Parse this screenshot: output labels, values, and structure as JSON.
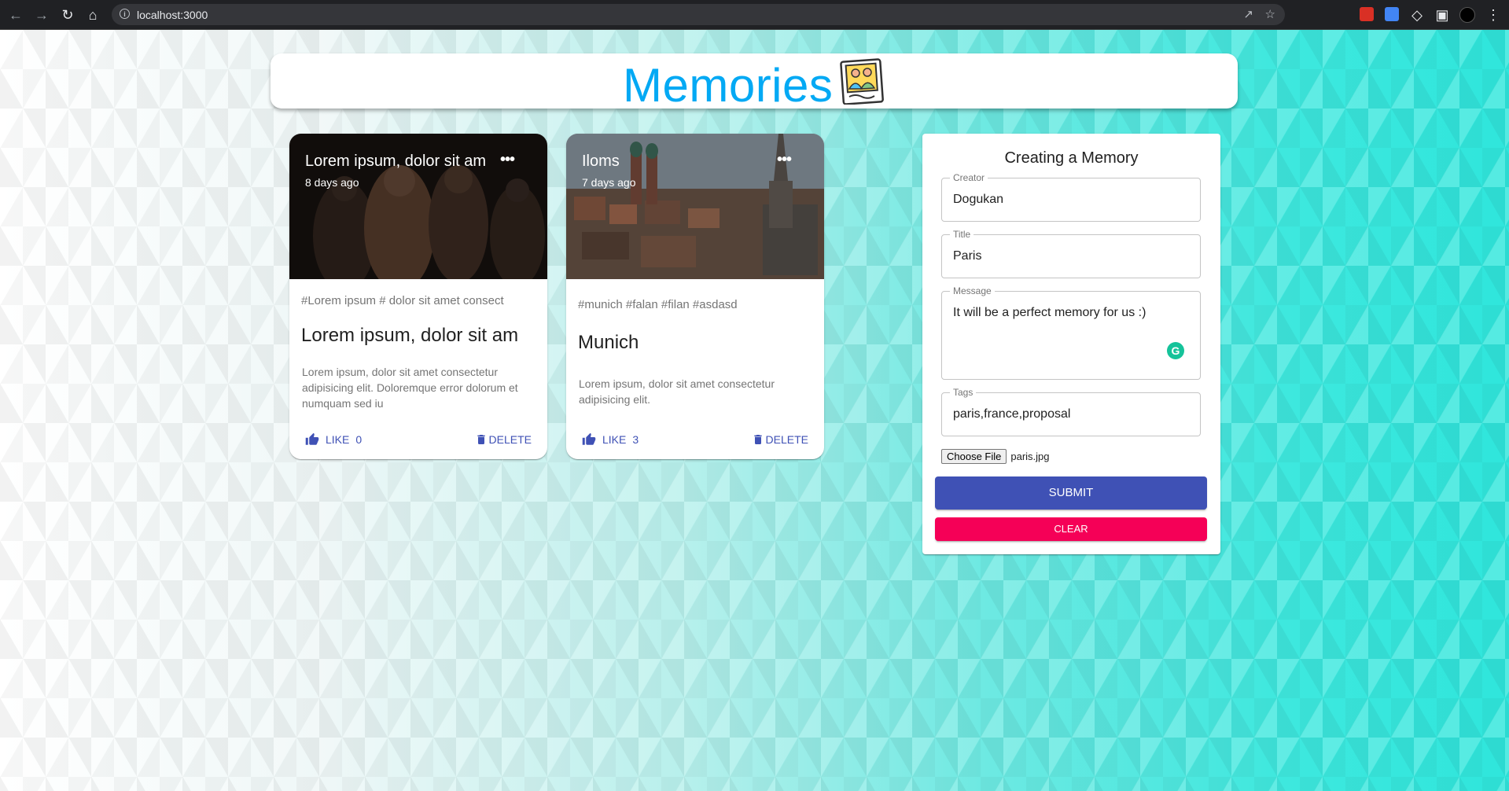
{
  "browser": {
    "url": "localhost:3000"
  },
  "app": {
    "heading": "Memories"
  },
  "posts": [
    {
      "overlay_title": "Lorem ipsum, dolor sit am",
      "time": "8 days ago",
      "tags": "#Lorem ipsum # dolor sit amet consect",
      "title": "Lorem ipsum, dolor sit am",
      "message": "Lorem ipsum, dolor sit amet consectetur adipisicing elit. Doloremque error dolorum et numquam sed iu",
      "like_label": "LIKE",
      "like_count": "0",
      "delete_label": "DELETE"
    },
    {
      "overlay_title": "Iloms",
      "time": "7 days ago",
      "tags": "#munich #falan #filan #asdasd",
      "title": "Munich",
      "message": "Lorem ipsum, dolor sit amet consectetur adipisicing elit.",
      "like_label": "LIKE",
      "like_count": "3",
      "delete_label": "DELETE"
    }
  ],
  "form": {
    "title": "Creating a Memory",
    "creator": {
      "label": "Creator",
      "value": "Dogukan"
    },
    "title_field": {
      "label": "Title",
      "value": "Paris"
    },
    "message": {
      "label": "Message",
      "value": "It will be a perfect memory for us :)"
    },
    "tags": {
      "label": "Tags",
      "value": "paris,france,proposal"
    },
    "file_button": "Choose File",
    "file_name": "paris.jpg",
    "submit_label": "SUBMIT",
    "clear_label": "CLEAR"
  },
  "colors": {
    "primary": "#3f51b5",
    "secondary": "#f50057",
    "heading": "#03a9f4"
  }
}
